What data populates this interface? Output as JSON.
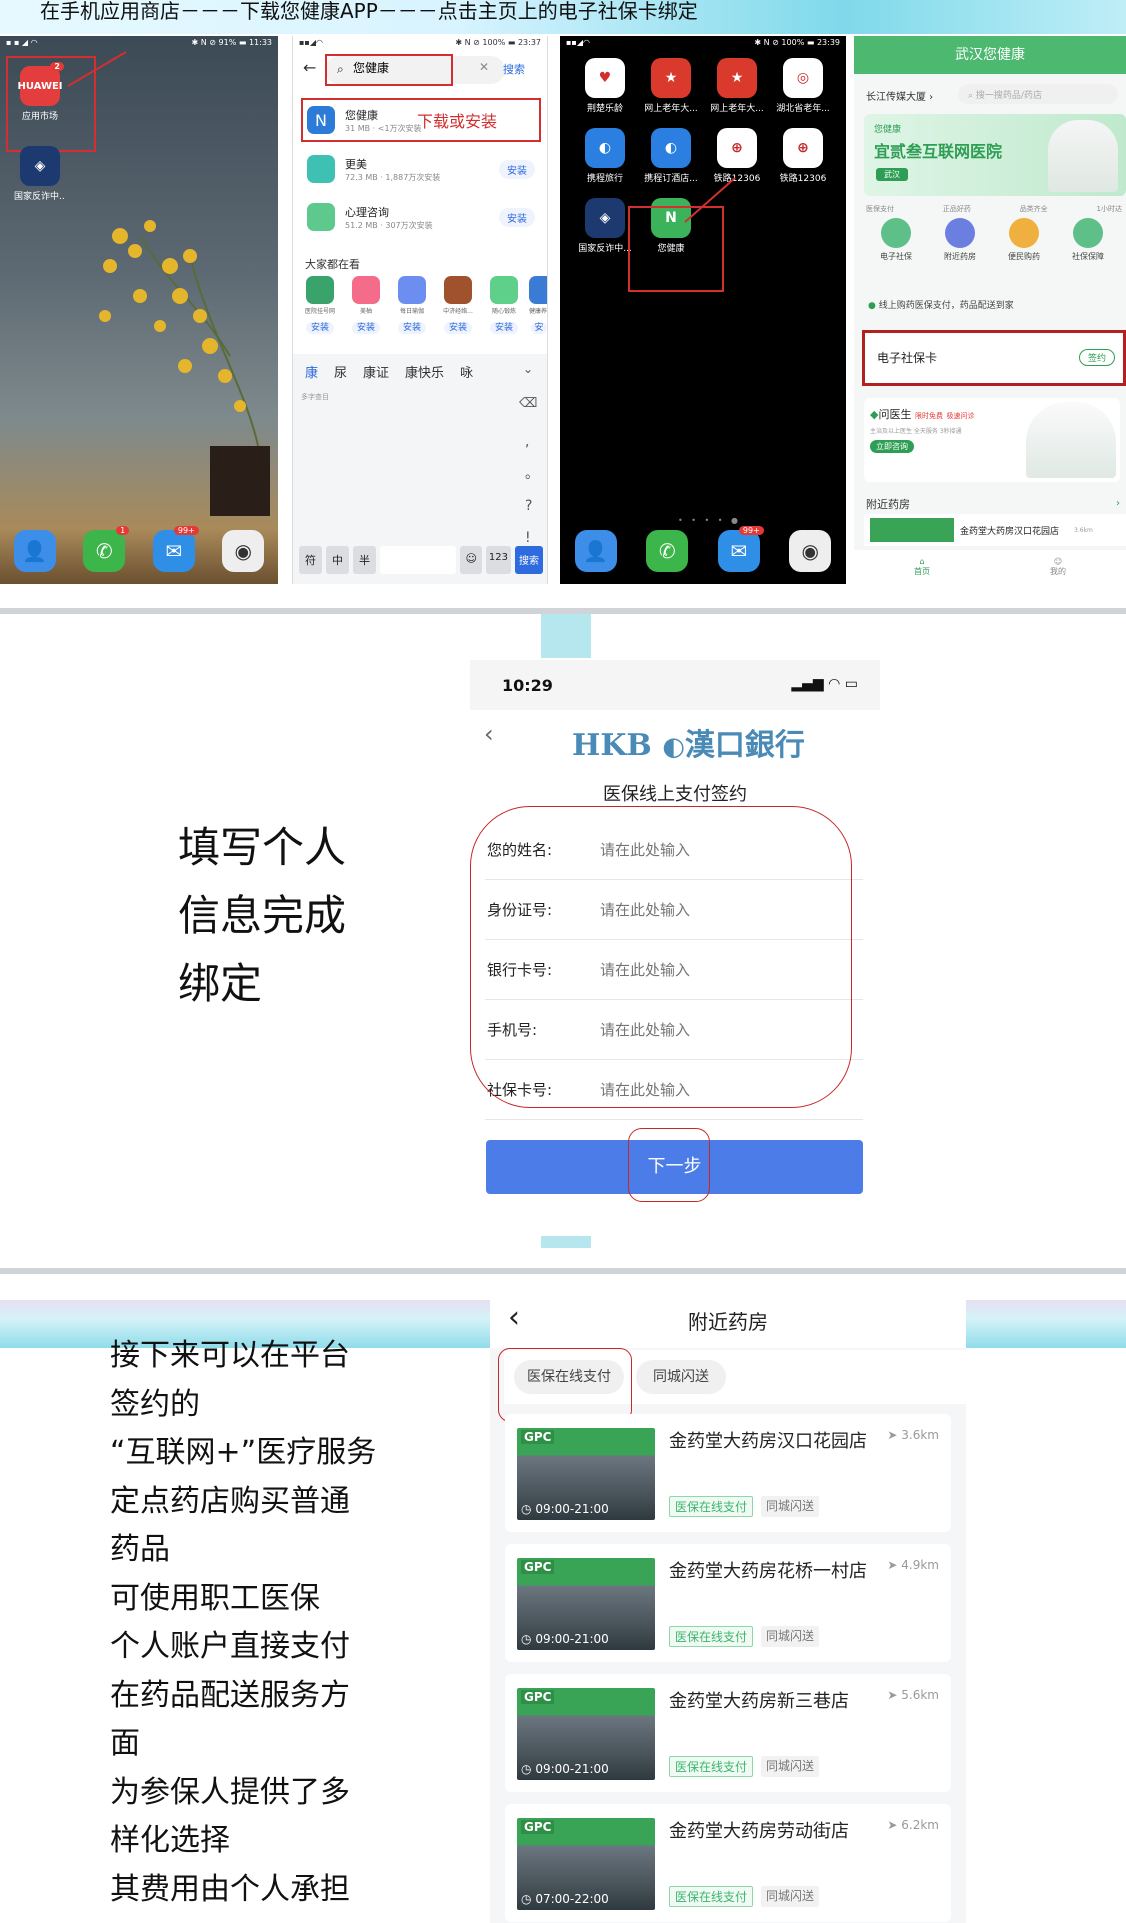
{
  "header": {
    "title": "在手机应用商店－－－下载您健康APP－－－点击主页上的电子社保卡绑定"
  },
  "phone1": {
    "status_left": "▪ ▪ ◢ ◠",
    "status_right": "✱ N ⊘ 91% ▬ 11:33",
    "app_market_label": "应用市场",
    "app_market_badge": "2",
    "anti_fraud_label": "国家反诈中..",
    "dock_phone_badge": "1",
    "dock_msg_badge": "99+"
  },
  "phone2": {
    "status_right": "✱ N ⊘ 100% ▬ 23:37",
    "search_value": "您健康",
    "search_button": "搜索",
    "annotation": "下载或安装",
    "results": [
      {
        "name": "您健康",
        "sub": "31 MB · <1万次安装"
      },
      {
        "name": "更美",
        "sub": "72.3 MB · 1,887万次安装",
        "btn": "安装"
      },
      {
        "name": "心理咨询",
        "sub": "51.2 MB · 307万次安装",
        "btn": "安装"
      }
    ],
    "hot_title": "大家都在看",
    "hot_apps": [
      {
        "name": "医院挂号网",
        "btn": "安装"
      },
      {
        "name": "美柚",
        "btn": "安装"
      },
      {
        "name": "每日瑜伽",
        "btn": "安装"
      },
      {
        "name": "中济经络...",
        "btn": "安装"
      },
      {
        "name": "随心锻炼",
        "btn": "安装"
      },
      {
        "name": "健康养...",
        "btn": "安"
      }
    ],
    "candidates": [
      "康",
      "尿",
      "康证",
      "康快乐",
      "咏"
    ],
    "pinyin_hint": "多字查目",
    "keys_bottom": [
      "符",
      "中",
      "半",
      "☺",
      "123",
      "搜索"
    ]
  },
  "phone3": {
    "status_right": "✱ N ⊘ 100% ▬ 23:39",
    "apps": [
      {
        "label": "荆楚乐龄"
      },
      {
        "label": "网上老年大..."
      },
      {
        "label": "网上老年大..."
      },
      {
        "label": "湖北省老年..."
      },
      {
        "label": "携程旅行"
      },
      {
        "label": "携程订酒店..."
      },
      {
        "label": "铁路12306"
      },
      {
        "label": "铁路12306"
      },
      {
        "label": "国家反诈中..."
      },
      {
        "label": "您健康"
      }
    ],
    "dock_msg_badge": "99+"
  },
  "phone4": {
    "title": "武汉您健康",
    "location": "长江传媒大厦",
    "search_placeholder": "搜一搜药品/药店",
    "banner_brand": "您健康",
    "banner_title": "宜贰叁互联网医院",
    "banner_city": "武汉",
    "features": [
      "医保支付",
      "正品好药",
      "品类齐全",
      "1小时达"
    ],
    "shortcuts": [
      "电子社保",
      "附近药房",
      "便民购药",
      "社保保障"
    ],
    "notice": "线上购药医保支付，药品配送到家",
    "ess_card": "电子社保卡",
    "ess_btn": "签约",
    "doctor_title": "问医生",
    "doctor_tag1": "限时免费",
    "doctor_tag2": "极速问诊",
    "doctor_sub": "主治及以上医生 全天服务 3秒接通",
    "doctor_btn": "立即咨询",
    "nearby_title": "附近药房",
    "nearby_store": "金药堂大药房汉口花园店",
    "nearby_dist": "3.6km",
    "nav_home": "首页",
    "nav_mine": "我的"
  },
  "sec2": {
    "instruction": [
      "填写个人",
      "信息完成",
      "绑定"
    ],
    "status_time": "10:29",
    "bank_logo": "HKB",
    "bank_name": "漢口銀行",
    "page_title": "医保线上支付签约",
    "fields": [
      {
        "label": "您的姓名:",
        "placeholder": "请在此处输入"
      },
      {
        "label": "身份证号:",
        "placeholder": "请在此处输入"
      },
      {
        "label": "银行卡号:",
        "placeholder": "请在此处输入"
      },
      {
        "label": "手机号:",
        "placeholder": "请在此处输入"
      },
      {
        "label": "社保卡号:",
        "placeholder": "请在此处输入"
      }
    ],
    "next_button": "下一步"
  },
  "sec3": {
    "description": [
      "接下来可以在平台",
      "签约的",
      "“互联网+”医疗服务",
      "定点药店购买普通",
      "药品",
      "可使用职工医保",
      "个人账户直接支付",
      "在药品配送服务方",
      "面",
      "为参保人提供了多",
      "样化选择",
      "其费用由个人承担"
    ],
    "page_title": "附近药房",
    "tab1": "医保在线支付",
    "tab2": "同城闪送",
    "pharmacies": [
      {
        "name": "金药堂大药房汉口花园店",
        "dist": "3.6km",
        "hours": "09:00-21:00",
        "tag1": "医保在线支付",
        "tag2": "同城闪送"
      },
      {
        "name": "金药堂大药房花桥一村店",
        "dist": "4.9km",
        "hours": "09:00-21:00",
        "tag1": "医保在线支付",
        "tag2": "同城闪送"
      },
      {
        "name": "金药堂大药房新三巷店",
        "dist": "5.6km",
        "hours": "09:00-21:00",
        "tag1": "医保在线支付",
        "tag2": "同城闪送"
      },
      {
        "name": "金药堂大药房劳动街店",
        "dist": "6.2km",
        "hours": "07:00-22:00",
        "tag1": "医保在线支付",
        "tag2": "同城闪送"
      }
    ],
    "store_sign": "GPC"
  }
}
